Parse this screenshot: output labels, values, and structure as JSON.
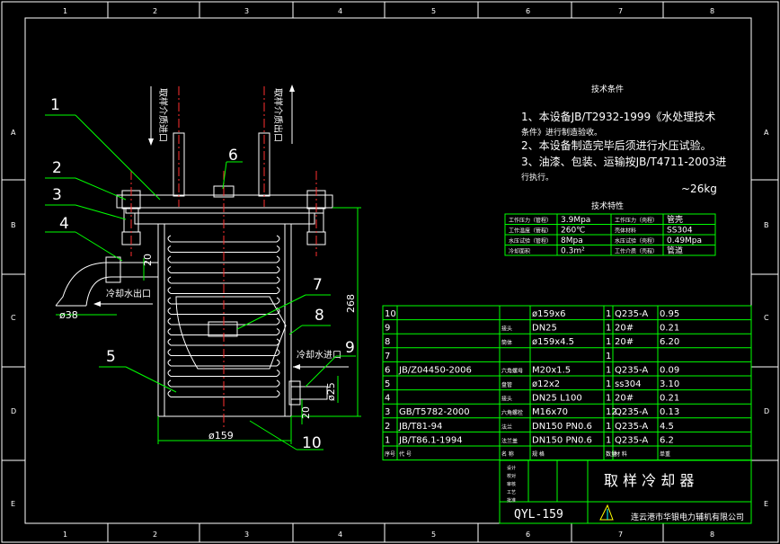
{
  "colors": {
    "background": "#000000",
    "frame": "#ffffff",
    "part": "#ffffff",
    "dimension": "#00ff00",
    "center": "#ff3030",
    "text": "#ffffff",
    "table": "#00ff00",
    "logo": "#ffff00"
  },
  "border": {
    "cols": [
      "1",
      "2",
      "3",
      "4",
      "5",
      "6",
      "7",
      "8"
    ],
    "rows": [
      "A",
      "B",
      "C",
      "D",
      "E"
    ]
  },
  "callouts": [
    "1",
    "2",
    "3",
    "4",
    "5",
    "6",
    "7",
    "8",
    "9",
    "10"
  ],
  "labels": {
    "sample_in": "取样介质进口",
    "sample_out": "取样介质出口",
    "coolant_out": "冷却水出口",
    "coolant_in": "冷却水进口"
  },
  "dimensions": {
    "d38": "ø38",
    "d20a": "20",
    "d268": "268",
    "d159": "ø159",
    "d25": "ø25",
    "d20b": "20"
  },
  "tech": {
    "title": "技术条件",
    "lines": [
      "1、本设备JB/T2932-1999《水处理技术",
      "条件》进行制造验收。",
      "2、本设备制造完毕后须进行水压试验。",
      "3、油漆、包装、运输按JB/T4711-2003进",
      "行执行。"
    ],
    "weight": "~26kg"
  },
  "spec": {
    "title": "技术特性",
    "rows": [
      [
        "工作压力（管程）",
        "3.9Mpa",
        "工作压力（壳程）",
        "管壳"
      ],
      [
        "工作温度（管程）",
        "260℃",
        "壳体材料",
        "SS304"
      ],
      [
        "水压试验（管程）",
        "8Mpa",
        "水压试验（壳程）",
        "0.49Mpa"
      ],
      [
        "冷却面积",
        "0.3m²",
        "工作介质（壳程）",
        "管道"
      ]
    ]
  },
  "bom": {
    "rows": [
      [
        "10",
        "",
        "",
        "ø159x6",
        "1",
        "Q235-A",
        "0.95"
      ],
      [
        "9",
        "",
        "接头",
        "DN25",
        "1",
        "20#",
        "0.21"
      ],
      [
        "8",
        "",
        "筒体",
        "ø159x4.5",
        "1",
        "20#",
        "6.20"
      ],
      [
        "7",
        "",
        "",
        "",
        "1",
        "",
        ""
      ],
      [
        "6",
        "JB/Z04450-2006",
        "六角螺母",
        "M20x1.5",
        "1",
        "Q235-A",
        "0.09"
      ],
      [
        "5",
        "",
        "盘管",
        "ø12x2",
        "1",
        "ss304",
        "3.10"
      ],
      [
        "4",
        "",
        "接头",
        "DN25  L100",
        "1",
        "20#",
        "0.21"
      ],
      [
        "3",
        "GB/T5782-2000",
        "六角螺栓",
        "M16x70",
        "12",
        "Q235-A",
        "0.13"
      ],
      [
        "2",
        "JB/T81-94",
        "法兰",
        "DN150  PN0.6",
        "1",
        "Q235-A",
        "4.5"
      ],
      [
        "1",
        "JB/T86.1-1994",
        "法兰盖",
        "DN150  PN0.6",
        "1",
        "Q235-A",
        "6.2"
      ]
    ],
    "header": [
      "序号",
      "代    号",
      "名    称",
      "规    格",
      "数量",
      "材  料",
      "单重"
    ]
  },
  "title_block": {
    "title": "取 样 冷 却 器",
    "model": "QYL-159",
    "company": "连云港市华银电力辅机有限公司",
    "small": [
      "设计",
      "校对",
      "审核",
      "工艺",
      "批准"
    ]
  }
}
